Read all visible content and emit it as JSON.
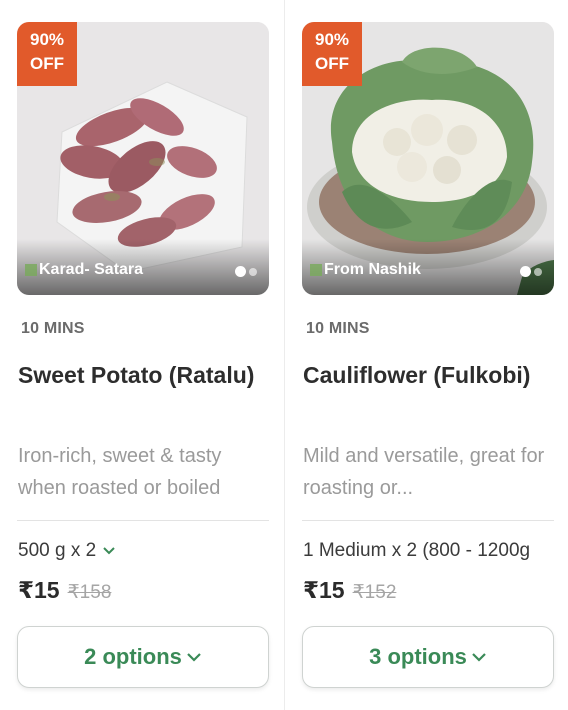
{
  "products": [
    {
      "discount_line1": "90%",
      "discount_line2": "OFF",
      "origin": "Karad- Satara",
      "eta": "10 MINS",
      "title": "Sweet Potato (Ratalu)",
      "description": "Iron-rich, sweet & tasty when roasted or boiled",
      "quantity": "500 g x 2",
      "price": "₹15",
      "mrp": "₹158",
      "options_label": "2 options",
      "image_icon": "sweet-potato-image"
    },
    {
      "discount_line1": "90%",
      "discount_line2": "OFF",
      "origin": "From Nashik",
      "eta": "10 MINS",
      "title": "Cauliflower (Fulkobi)",
      "description": "Mild and versatile, great for roasting or...",
      "quantity": "1 Medium x 2 (800 - 1200g",
      "price": "₹15",
      "mrp": "₹152",
      "options_label": "3 options",
      "image_icon": "cauliflower-image"
    }
  ],
  "colors": {
    "badge": "#e15a2b",
    "accent_green": "#3a8a57"
  }
}
